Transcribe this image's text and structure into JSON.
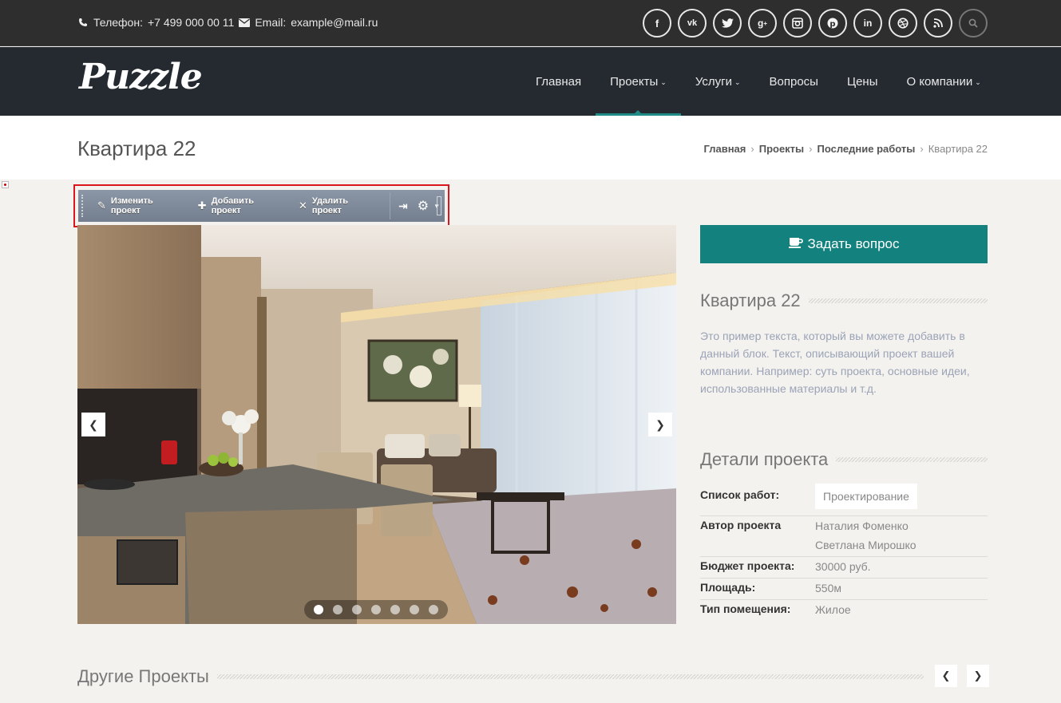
{
  "topbar": {
    "phone_label": "Телефон:",
    "phone_value": "+7 499 000 00 11",
    "email_label": "Email:",
    "email_value": "example@mail.ru",
    "socials": [
      "f",
      "vk",
      "t",
      "g+",
      "ig",
      "p",
      "in",
      "dr",
      "rss",
      "search"
    ]
  },
  "nav": {
    "logo": "Puzzle",
    "items": [
      {
        "label": "Главная",
        "has_dropdown": false
      },
      {
        "label": "Проекты",
        "has_dropdown": true,
        "active": true
      },
      {
        "label": "Услуги",
        "has_dropdown": true
      },
      {
        "label": "Вопросы",
        "has_dropdown": false
      },
      {
        "label": "Цены",
        "has_dropdown": false
      },
      {
        "label": "О компании",
        "has_dropdown": true
      }
    ]
  },
  "page": {
    "title": "Квартира 22",
    "breadcrumbs": [
      "Главная",
      "Проекты",
      "Последние работы",
      "Квартира 22"
    ]
  },
  "admin_toolbar": {
    "edit": "Изменить проект",
    "add": "Добавить проект",
    "delete": "Удалить проект"
  },
  "slider": {
    "slide_count": 7,
    "active_slide": 1
  },
  "sidebar": {
    "ask_button": "Задать вопрос",
    "project_title": "Квартира 22",
    "description": "Это пример текста, который вы можете добавить в данный блок. Текст, описывающий проект вашей компании. Например: суть проекта, основные идеи, использованные материалы и т.д.",
    "details_title": "Детали проекта",
    "details": {
      "works_label": "Список работ:",
      "works_value": "Проектирование",
      "author_label": "Автор проекта",
      "author_1": "Наталия Фоменко",
      "author_2": "Светлана Мирошко",
      "budget_label": "Бюджет проекта:",
      "budget_value": "30000 руб.",
      "area_label": "Площадь:",
      "area_value": "550м",
      "type_label": "Тип помещения:",
      "type_value": "Жилое"
    }
  },
  "other_projects": {
    "title": "Другие Проекты"
  },
  "colors": {
    "accent": "#13827e",
    "topbar": "#2e2e2e",
    "navbar": "#242a30",
    "highlight_frame": "#d8161c"
  }
}
